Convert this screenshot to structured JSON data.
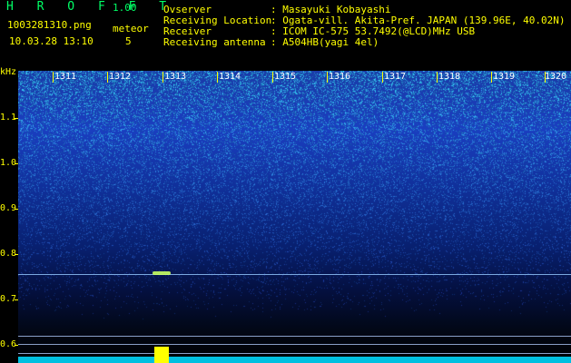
{
  "header": {
    "title": "H R O F F T",
    "version": "1.00",
    "filename": "1003281310.png",
    "datetime": "10.03.28 13:10",
    "meteor_label": "meteor",
    "meteor_count": "5"
  },
  "info": [
    {
      "key": "Ovserver",
      "value": ": Masayuki Kobayashi"
    },
    {
      "key": "Receiving Location",
      "value": ": Ogata-vill. Akita-Pref. JAPAN (139.96E, 40.02N)"
    },
    {
      "key": "Receiver",
      "value": ": ICOM IC-575 53.7492(@LCD)MHz USB"
    },
    {
      "key": "Receiving antenna",
      "value": ": A504HB(yagi 4el)"
    }
  ],
  "y_axis": {
    "label": "kHz",
    "ticks": [
      "1.1",
      "1.0",
      "0.9",
      "0.8",
      "0.7",
      "0.6"
    ]
  },
  "x_axis": {
    "ticks": [
      "1311",
      "1312",
      "1313",
      "1314",
      "1315",
      "1316",
      "1317",
      "1318",
      "1319",
      "1320"
    ]
  },
  "colors": {
    "header_text": "#ffff00",
    "title": "#00ff66",
    "spectrum_high": "#1a3ec0",
    "carrier": "#7aa8e0",
    "meteor": "#ffff00"
  }
}
